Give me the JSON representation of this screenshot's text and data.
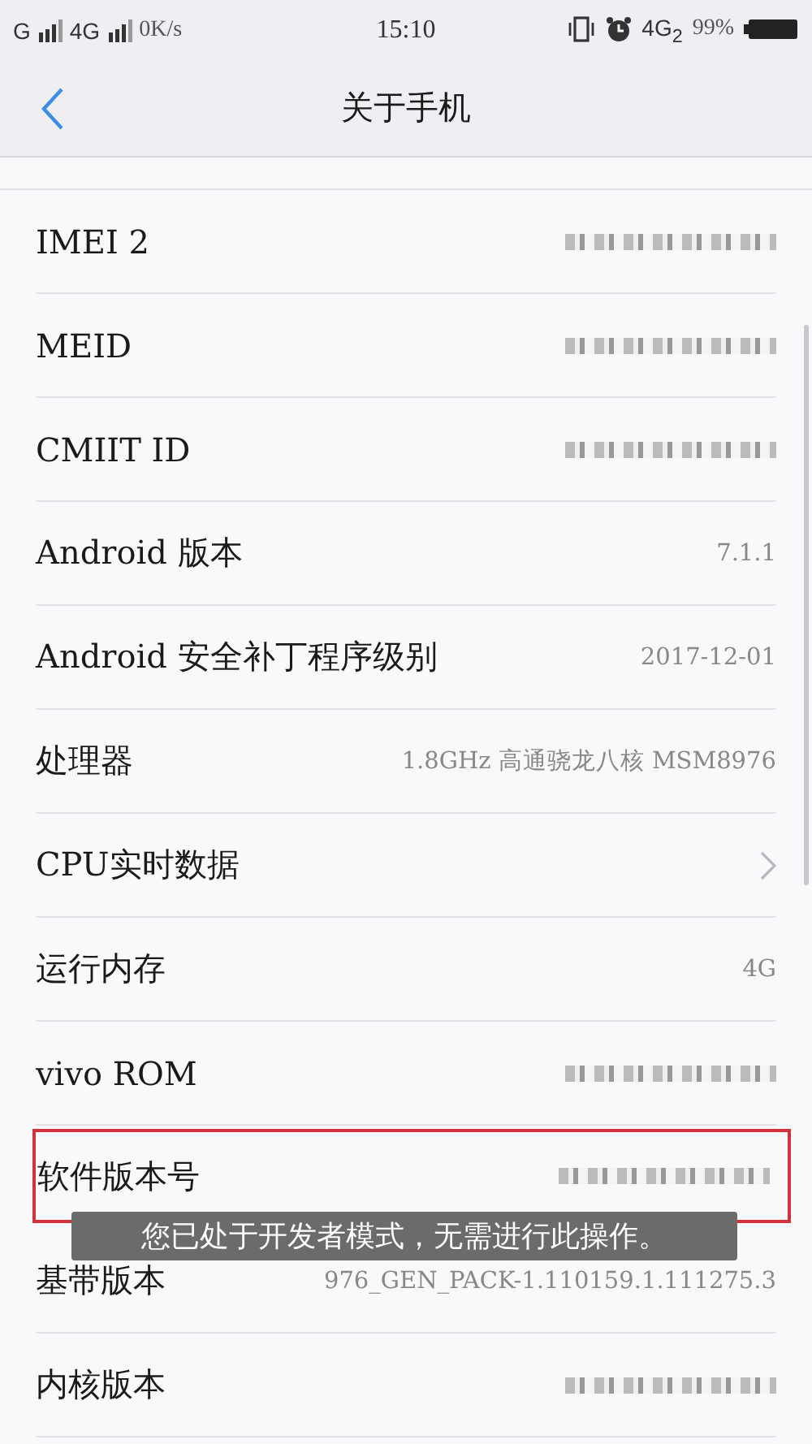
{
  "status_bar": {
    "sim1": "G",
    "sim2": "4G",
    "speed": "0K/s",
    "time": "15:10",
    "network": "4G$_{2}$",
    "battery": "99%"
  },
  "nav": {
    "title": "关于手机"
  },
  "rows": [
    {
      "label": "IMEI 2",
      "kind": "blurred",
      "highlighted": false
    },
    {
      "label": "MEID",
      "kind": "blurred",
      "highlighted": false
    },
    {
      "label": "CMIIT ID",
      "kind": "blurred",
      "highlighted": false
    },
    {
      "label": "Android 版本",
      "kind": "text",
      "value": "7.1.1",
      "highlighted": false
    },
    {
      "label": "Android 安全补丁程序级别",
      "kind": "text",
      "value": "2017-12-01",
      "highlighted": false
    },
    {
      "label": "处理器",
      "kind": "text",
      "value": "1.8GHz 高通骁龙八核 MSM8976",
      "highlighted": false
    },
    {
      "label": "CPU实时数据",
      "kind": "link",
      "highlighted": false
    },
    {
      "label": "运行内存",
      "kind": "text",
      "value": "4G",
      "highlighted": false
    },
    {
      "label": "vivo ROM",
      "kind": "blurred",
      "highlighted": false
    },
    {
      "label": "软件版本号",
      "kind": "blurred",
      "highlighted": true
    },
    {
      "label": "基带版本",
      "kind": "text",
      "value": "976_GEN_PACK-1.110159.1.111275.3",
      "highlighted": false
    },
    {
      "label": "内核版本",
      "kind": "blurred",
      "highlighted": false
    }
  ],
  "toast": {
    "text": "您已处于开发者模式，无需进行此操作。"
  }
}
